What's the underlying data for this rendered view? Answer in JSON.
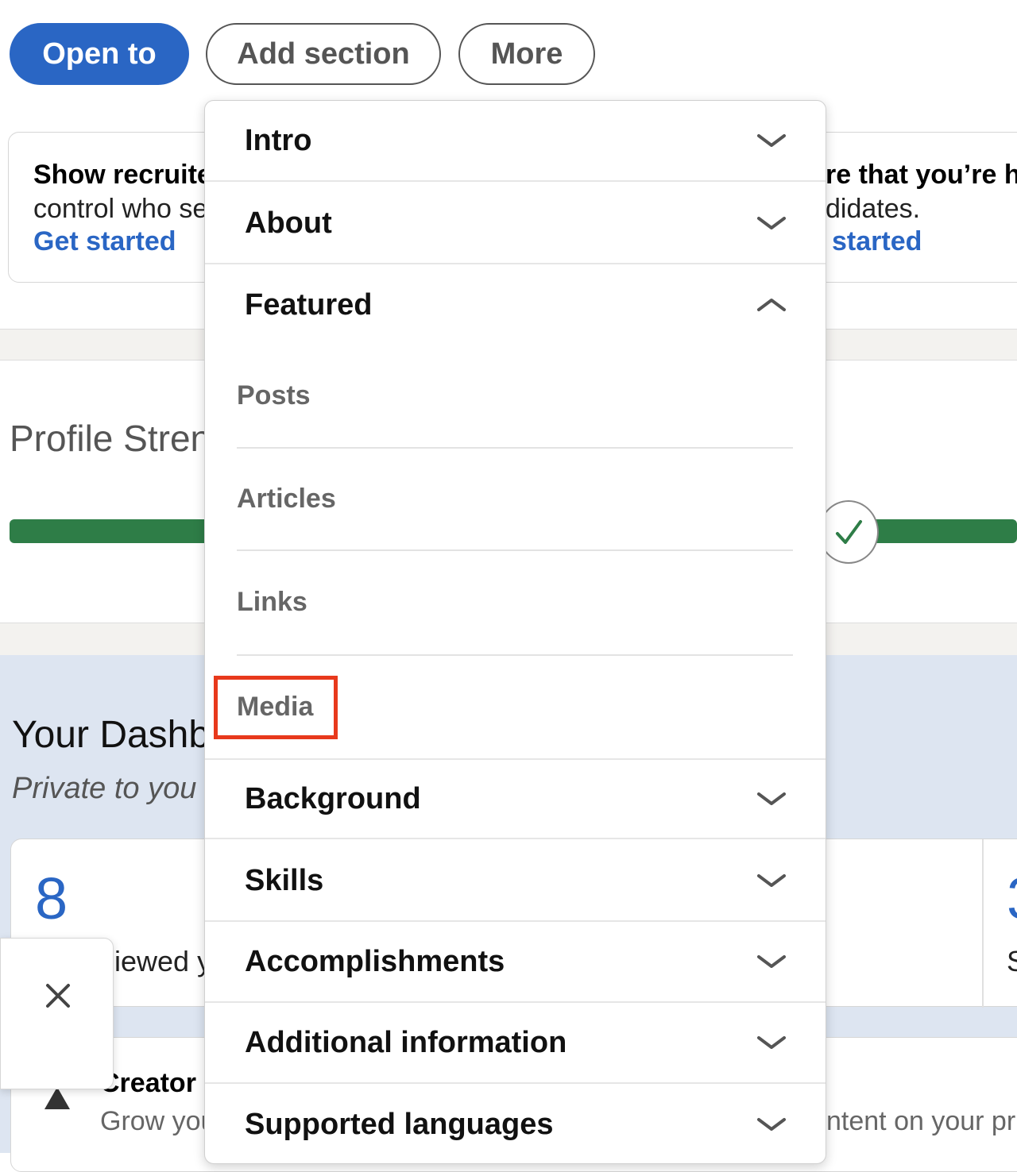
{
  "top_buttons": {
    "open_to": "Open to",
    "add_section": "Add section",
    "more": "More"
  },
  "banner_left": {
    "title": "Show recruite",
    "body": "control who se",
    "link": "Get started"
  },
  "banner_right": {
    "title": "re that you’re h",
    "body": "didates.",
    "link": "started"
  },
  "profile_strength": {
    "title": "Profile Stren",
    "progress_percent": 100
  },
  "dashboard": {
    "title": "Your Dashb",
    "subtitle": "Private to you",
    "stat_left_value": "8",
    "stat_left_label": "iewed y",
    "stat_right_value": "3",
    "stat_right_label": "S"
  },
  "creator": {
    "title": "Creator",
    "body_left": "Grow you",
    "body_right": "ntent on your pr"
  },
  "menu": {
    "intro": "Intro",
    "about": "About",
    "featured": "Featured",
    "featured_items": [
      "Posts",
      "Articles",
      "Links",
      "Media"
    ],
    "background": "Background",
    "skills": "Skills",
    "accomplishments": "Accomplishments",
    "additional": "Additional information",
    "languages": "Supported languages"
  },
  "colors": {
    "primary": "#2a66c4",
    "progress": "#2e7d47",
    "highlight": "#e8391c"
  }
}
